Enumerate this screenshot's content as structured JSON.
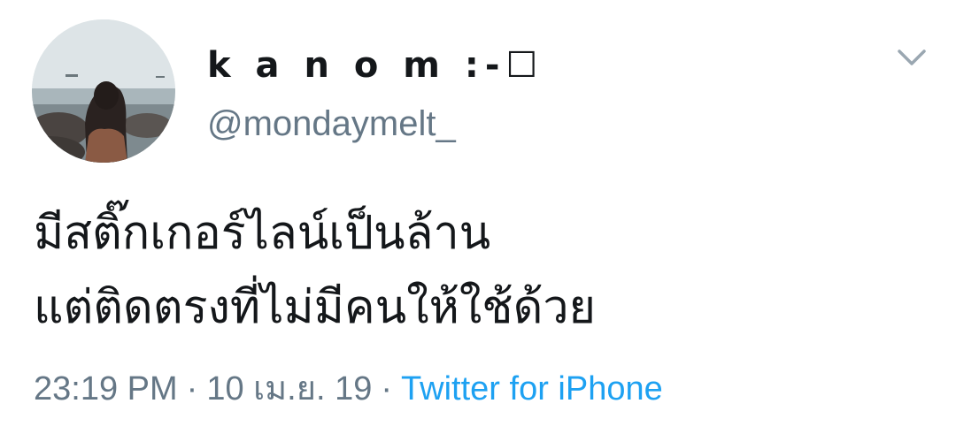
{
  "user": {
    "display_name": "k a n o m :-☐",
    "handle": "@mondaymelt_"
  },
  "tweet": {
    "text_lines": [
      "มีสติ๊กเกอร์ไลน์เป็นล้าน",
      "แต่ติดตรงที่ไม่มีคนให้ใช้ด้วย"
    ],
    "time": "23:19 PM",
    "date": "10 เม.ย. 19",
    "separator": "·",
    "source": "Twitter for iPhone"
  },
  "icons": {
    "menu": "chevron-down-icon",
    "avatar": "profile-photo"
  },
  "colors": {
    "text": "#14171a",
    "secondary": "#657786",
    "link": "#1da1f2",
    "chevron": "#9aa7b1"
  }
}
